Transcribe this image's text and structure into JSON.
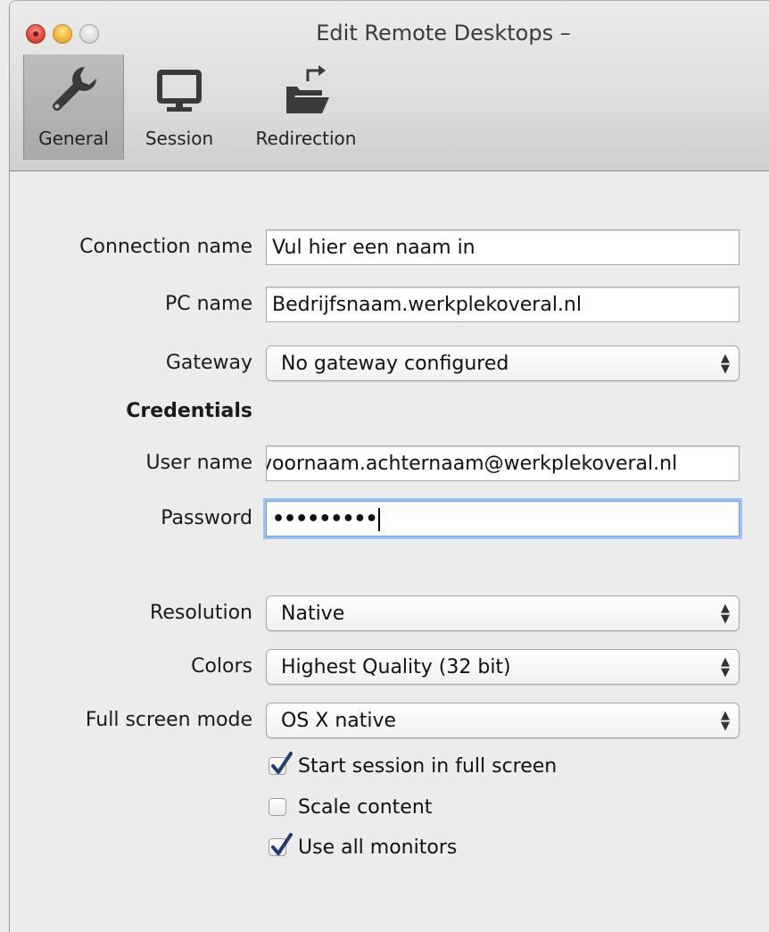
{
  "window": {
    "title": "Edit Remote Desktops –"
  },
  "toolbar": {
    "items": [
      {
        "label": "General",
        "icon": "wrench-icon",
        "selected": true
      },
      {
        "label": "Session",
        "icon": "monitor-icon",
        "selected": false
      },
      {
        "label": "Redirection",
        "icon": "folder-redirect-icon",
        "selected": false
      }
    ]
  },
  "form": {
    "connection_name": {
      "label": "Connection name",
      "value": "Vul hier een naam in"
    },
    "pc_name": {
      "label": "PC name",
      "value": "Bedrijfsnaam.werkplekoveral.nl"
    },
    "gateway": {
      "label": "Gateway",
      "value": "No gateway configured"
    },
    "credentials_heading": "Credentials",
    "user_name": {
      "label": "User name",
      "value": "voornaam.achternaam@werkplekoveral.nl"
    },
    "password": {
      "label": "Password",
      "value": "•••••••••"
    },
    "resolution": {
      "label": "Resolution",
      "value": "Native"
    },
    "colors": {
      "label": "Colors",
      "value": "Highest Quality (32 bit)"
    },
    "full_screen_mode": {
      "label": "Full screen mode",
      "value": "OS X native"
    },
    "checkboxes": [
      {
        "label": "Start session in full screen",
        "checked": true
      },
      {
        "label": "Scale content",
        "checked": false
      },
      {
        "label": "Use all monitors",
        "checked": true
      }
    ]
  },
  "colors": {
    "focus_ring": "#9cc3ef",
    "checkmark": "#1f3d73",
    "close_button": "#e2463a",
    "minimize_button": "#f2b431"
  }
}
